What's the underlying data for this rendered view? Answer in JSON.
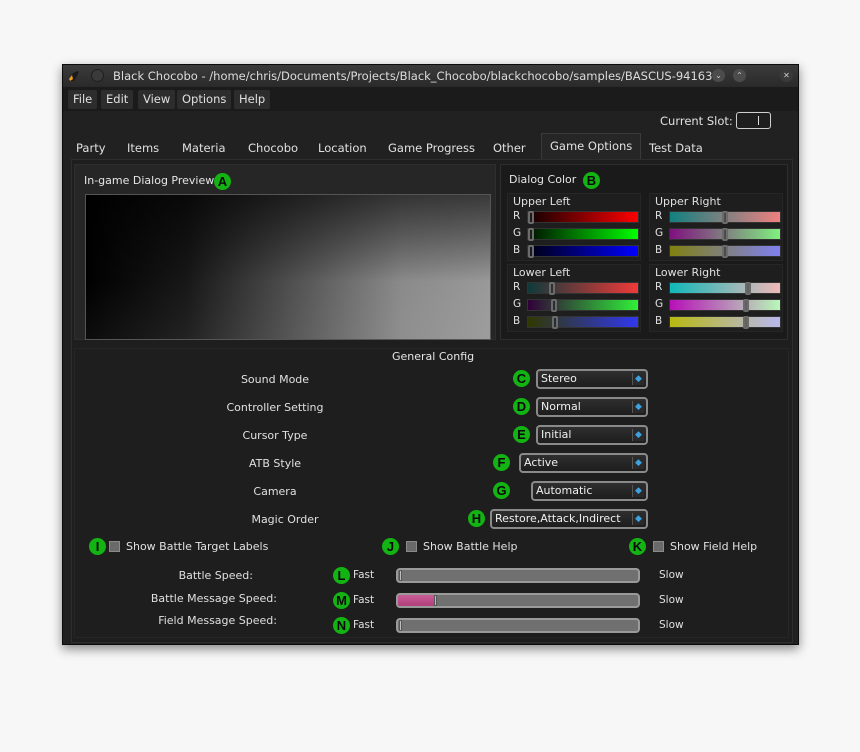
{
  "window": {
    "title": "Black Chocobo - /home/chris/Documents/Projects/Black_Chocobo/blackchocobo/samples/BASCUS-94163...",
    "buttons": {
      "minimize": "⌄",
      "maximize": "⌃",
      "close": "✕"
    }
  },
  "menu": [
    {
      "label": "File"
    },
    {
      "label": "Edit"
    },
    {
      "label": "View"
    },
    {
      "label": "Options"
    },
    {
      "label": "Help"
    }
  ],
  "current_slot": {
    "label": "Current Slot:",
    "value": ""
  },
  "tabs": [
    {
      "label": "Party"
    },
    {
      "label": "Items"
    },
    {
      "label": "Materia"
    },
    {
      "label": "Chocobo"
    },
    {
      "label": "Location"
    },
    {
      "label": "Game Progress"
    },
    {
      "label": "Other"
    },
    {
      "label": "Game Options",
      "active": true
    },
    {
      "label": "Test Data"
    }
  ],
  "dialog_preview": {
    "title": "In-game Dialog Preview",
    "marker": "A"
  },
  "dialog_color": {
    "title": "Dialog Color",
    "marker": "B",
    "corners": [
      {
        "title": "Upper Left",
        "r": 0,
        "g": 0,
        "b": 0
      },
      {
        "title": "Upper Right",
        "r": 0.5,
        "g": 0.5,
        "b": 0.5
      },
      {
        "title": "Lower Left",
        "r": 0.2,
        "g": 0.22,
        "b": 0.23
      },
      {
        "title": "Lower Right",
        "r": 0.72,
        "g": 0.7,
        "b": 0.7
      }
    ],
    "channel_labels": {
      "r": "R",
      "g": "G",
      "b": "B"
    }
  },
  "general_config": {
    "title": "General Config",
    "settings": [
      {
        "label": "Sound Mode",
        "value": "Stereo",
        "marker": "C"
      },
      {
        "label": "Controller Setting",
        "value": "Normal",
        "marker": "D"
      },
      {
        "label": "Cursor Type",
        "value": "Initial",
        "marker": "E"
      },
      {
        "label": "ATB Style",
        "value": "Active",
        "marker": "F"
      },
      {
        "label": "Camera",
        "value": "Automatic",
        "marker": "G"
      },
      {
        "label": "Magic Order",
        "value": "Restore,Attack,Indirect",
        "marker": "H"
      }
    ],
    "checkboxes": [
      {
        "label": "Show Battle Target Labels",
        "checked": false,
        "marker": "I"
      },
      {
        "label": "Show Battle Help",
        "checked": false,
        "marker": "J"
      },
      {
        "label": "Show Field Help",
        "checked": false,
        "marker": "K"
      }
    ],
    "speeds": [
      {
        "label": "Battle Speed:",
        "min_label": "Fast",
        "max_label": "Slow",
        "value": 0,
        "marker": "L"
      },
      {
        "label": "Battle Message Speed:",
        "min_label": "Fast",
        "max_label": "Slow",
        "value": 0.15,
        "marker": "M"
      },
      {
        "label": "Field Message Speed:",
        "min_label": "Fast",
        "max_label": "Slow",
        "value": 0,
        "marker": "N"
      }
    ]
  },
  "colors": {
    "marker_green": "#13b313",
    "accent_pink": "#c95b97",
    "combo_arrow": "#3ea1e0"
  }
}
